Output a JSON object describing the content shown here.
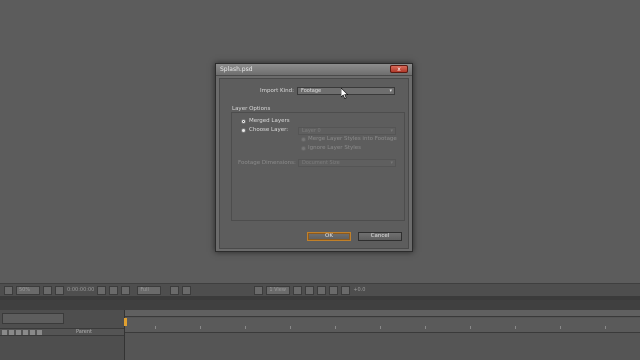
{
  "viewer_toolbar": {
    "zoom": "50%",
    "timecode": "0:00:00:00",
    "resolution": "Full",
    "view": "1 View",
    "exposure": "+0.0"
  },
  "timeline": {
    "column_header": "Parent"
  },
  "dialog": {
    "title": "Splash.psd",
    "close_label": "x",
    "import_kind_label": "Import Kind:",
    "import_kind_value": "Footage",
    "layer_options_label": "Layer Options",
    "merged_layers_label": "Merged Layers",
    "choose_layer_label": "Choose Layer:",
    "choose_layer_value": "Layer 0",
    "merge_styles_label": "Merge Layer Styles into Footage",
    "ignore_styles_label": "Ignore Layer Styles",
    "footage_dimensions_label": "Footage Dimensions:",
    "footage_dimensions_value": "Document Size",
    "ok_label": "OK",
    "cancel_label": "Cancel"
  }
}
